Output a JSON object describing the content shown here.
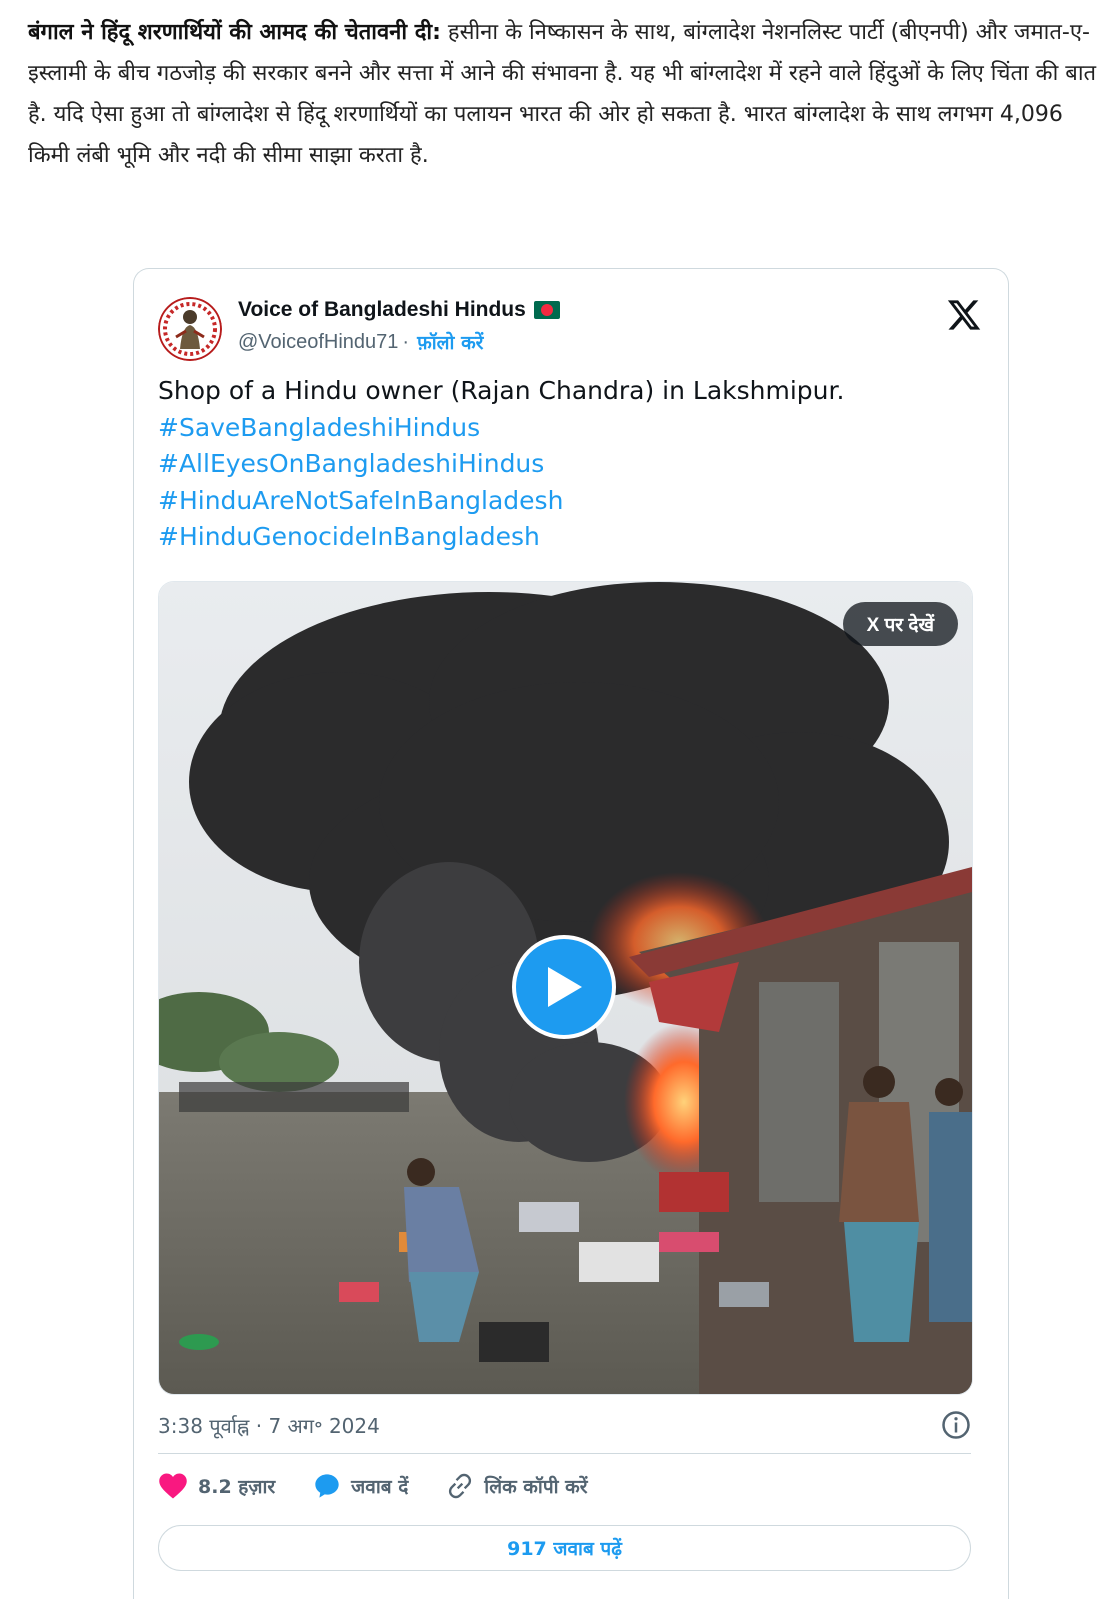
{
  "article": {
    "lead_bold": "बंगाल ने हिंदू शरणार्थियों की आमद की चेतावनी दी:",
    "body": "हसीना के निष्कासन के साथ, बांग्लादेश नेशनलिस्ट पार्टी (बीएनपी) और जमात-ए-इस्लामी के बीच गठजोड़ की सरकार बनने और सत्ता में आने की संभावना है. यह भी बांग्लादेश में रहने वाले हिंदुओं के लिए चिंता की बात है. यदि ऐसा हुआ तो बांग्लादेश से हिंदू शरणार्थियों का पलायन भारत की ओर हो सकता है. भारत बांग्लादेश के साथ लगभग 4,096 किमी लंबी भूमि और नदी की सीमा साझा करता है."
  },
  "tweet": {
    "author_name": "Voice of Bangladeshi Hindus",
    "handle": "@VoiceofHindu71",
    "separator": "·",
    "follow_label": "फ़ॉलो करें",
    "text": "Shop of a Hindu owner (Rajan Chandra) in Lakshmipur.",
    "hashtags": [
      "#SaveBangladeshiHindus",
      "#AllEyesOnBangladeshiHindus",
      "#HinduAreNotSafeInBangladesh",
      "#HinduGenocideInBangladesh"
    ],
    "view_on_x": "X पर देखें",
    "timestamp": "3:38 पूर्वाह्न · 7 अग॰ 2024",
    "likes": "8.2 हज़ार",
    "reply_label": "जवाब दें",
    "copy_link_label": "लिंक कॉपी करें",
    "read_replies": "917 जवाब पढ़ें"
  },
  "colors": {
    "link": "#1d9bf0",
    "heart": "#f91880",
    "muted": "#536471"
  }
}
